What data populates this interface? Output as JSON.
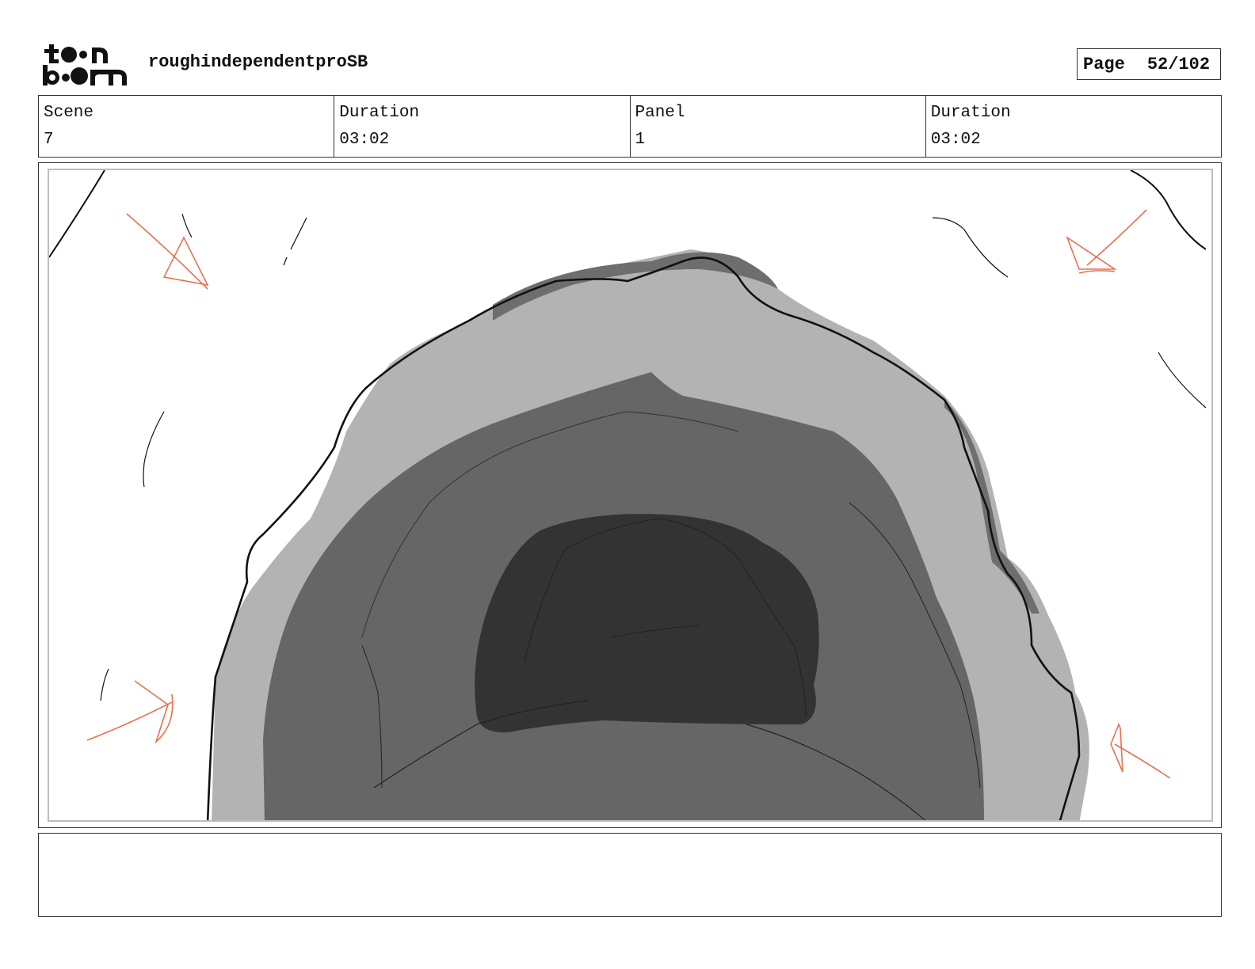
{
  "header": {
    "logo_text": "toonboom",
    "project_title": "roughindependentproSB",
    "page_label": "Page",
    "page_value": "52/102"
  },
  "info": {
    "scene_label": "Scene",
    "scene_value": "7",
    "scene_duration_label": "Duration",
    "scene_duration_value": "03:02",
    "panel_label": "Panel",
    "panel_value": "1",
    "panel_duration_label": "Duration",
    "panel_duration_value": "03:02"
  },
  "panel": {
    "drawing": "cave-entrance-sketch",
    "annotation_color": "#e8704f",
    "tones": [
      "#b3b3b3",
      "#8c8c8c",
      "#666666",
      "#333333"
    ]
  },
  "notes": {
    "text": ""
  }
}
